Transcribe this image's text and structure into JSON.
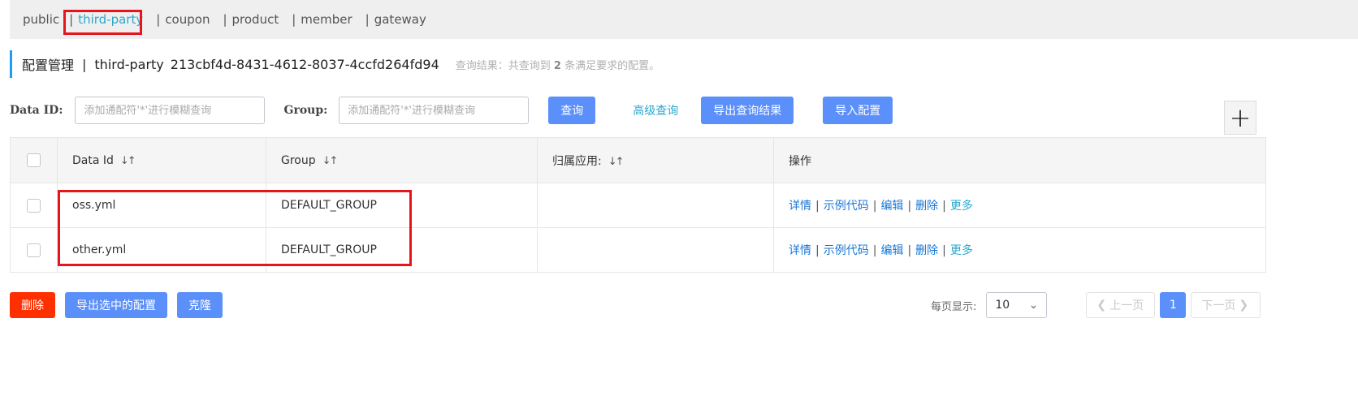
{
  "namespaces": [
    {
      "name": "public",
      "active": false
    },
    {
      "name": "third-party",
      "active": true
    },
    {
      "name": "coupon",
      "active": false
    },
    {
      "name": "product",
      "active": false
    },
    {
      "name": "member",
      "active": false
    },
    {
      "name": "gateway",
      "active": false
    }
  ],
  "separator": "|",
  "title": {
    "main": "配置管理",
    "sep": "|",
    "namespace": "third-party",
    "namespace_id": "213cbf4d-8431-4612-8037-4ccfd264fd94",
    "result_prefix": "查询结果：共查询到",
    "result_count": "2",
    "result_suffix": "条满足要求的配置。"
  },
  "search": {
    "data_id_label": "Data ID:",
    "data_id_placeholder": "添加通配符'*'进行模糊查询",
    "group_label": "Group:",
    "group_placeholder": "添加通配符'*'进行模糊查询",
    "query_button": "查询",
    "advanced_query": "高级查询",
    "export_results": "导出查询结果",
    "import_config": "导入配置"
  },
  "add_icon": "plus-icon",
  "table": {
    "headers": {
      "data_id": "Data Id",
      "group": "Group",
      "app": "归属应用:",
      "ops": "操作"
    },
    "sort_glyph": "↓↑",
    "rows": [
      {
        "data_id": "oss.yml",
        "group": "DEFAULT_GROUP",
        "app": ""
      },
      {
        "data_id": "other.yml",
        "group": "DEFAULT_GROUP",
        "app": ""
      }
    ],
    "ops": {
      "detail": "详情",
      "sample": "示例代码",
      "edit": "编辑",
      "delete": "删除",
      "more": "更多",
      "sep": "|"
    }
  },
  "bottom": {
    "delete": "删除",
    "export_selected": "导出选中的配置",
    "clone": "克隆"
  },
  "pager": {
    "page_size_label": "每页显示:",
    "page_size": "10",
    "prev": "上一页",
    "current": "1",
    "next": "下一页"
  },
  "colors": {
    "primary": "#5b8ff9",
    "danger": "#ff3000",
    "link": "#1776d6",
    "accent": "#2aa8cc",
    "highlight": "#e6141b"
  }
}
